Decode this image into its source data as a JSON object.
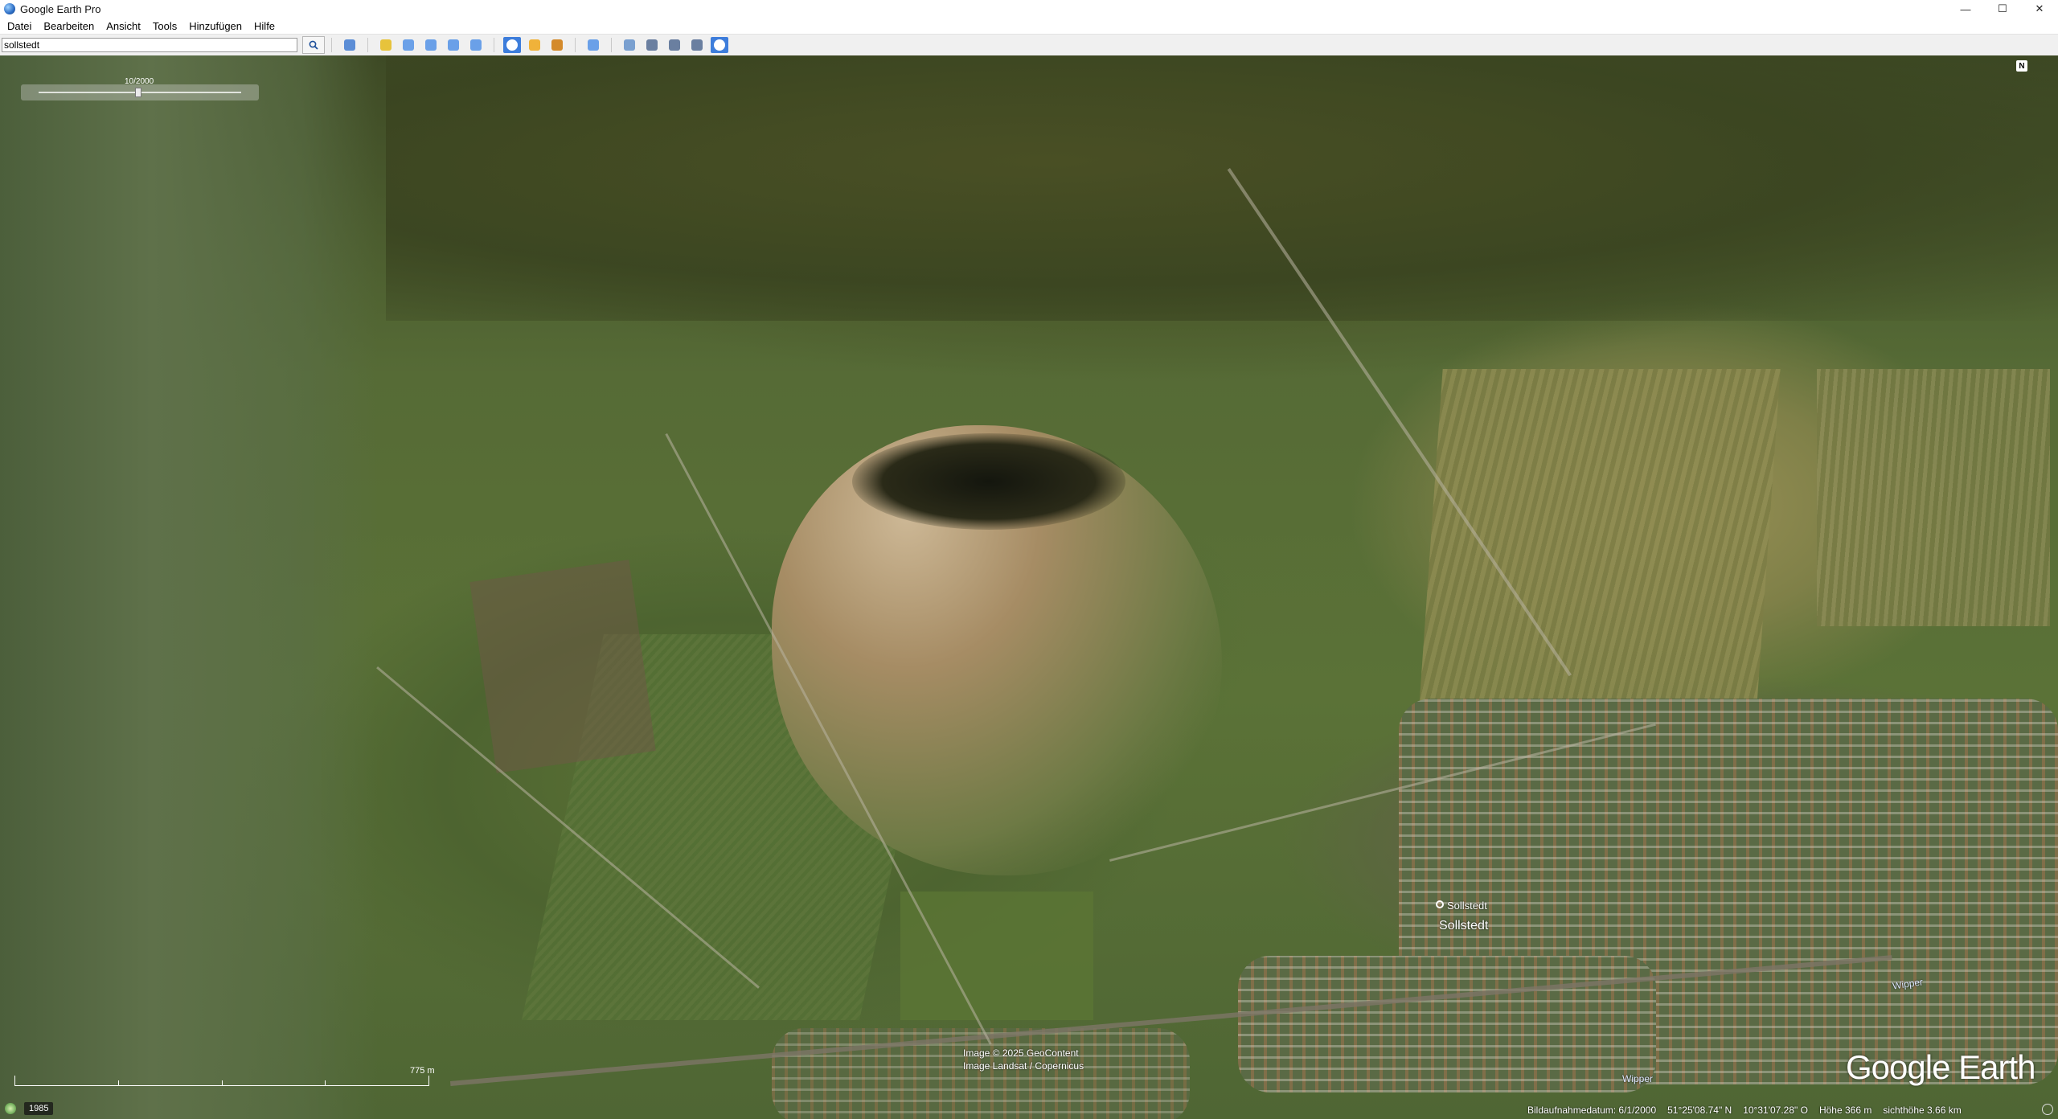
{
  "window": {
    "title": "Google Earth Pro",
    "controls": {
      "minimize": "—",
      "maximize": "☐",
      "close": "✕"
    }
  },
  "menu": {
    "items": [
      "Datei",
      "Bearbeiten",
      "Ansicht",
      "Tools",
      "Hinzufügen",
      "Hilfe"
    ]
  },
  "toolbar": {
    "search_value": "sollstedt",
    "buttons": [
      {
        "icon": "sidebar-toggle-icon",
        "color": "#5b8dd6"
      },
      {
        "icon": "placemark-icon",
        "color": "#e7c33b"
      },
      {
        "icon": "polygon-icon",
        "color": "#6aa0e8"
      },
      {
        "icon": "path-icon",
        "color": "#6aa0e8"
      },
      {
        "icon": "image-overlay-icon",
        "color": "#6aa0e8"
      },
      {
        "icon": "tour-record-icon",
        "color": "#6aa0e8"
      },
      {
        "icon": "historical-imagery-icon",
        "color": "#3d7ddb",
        "active": true
      },
      {
        "icon": "sunlight-icon",
        "color": "#f0b23a"
      },
      {
        "icon": "planets-icon",
        "color": "#d48a2a"
      },
      {
        "icon": "ruler-icon",
        "color": "#6aa0e8"
      },
      {
        "icon": "email-icon",
        "color": "#7aa0d0"
      },
      {
        "icon": "print-icon",
        "color": "#6a7fa0"
      },
      {
        "icon": "save-image-icon",
        "color": "#6a7fa0"
      },
      {
        "icon": "view-maps-icon",
        "color": "#6a7fa0"
      },
      {
        "icon": "earth-view-icon",
        "color": "#3d7ddb",
        "active": true
      }
    ]
  },
  "map": {
    "time_slider_label": "10/2000",
    "compass_label": "N",
    "places": [
      {
        "name": "Sollstedt",
        "variant": "town"
      },
      {
        "name": "Sollstedt",
        "variant": "pin"
      },
      {
        "name": "Wipper",
        "variant": "river"
      },
      {
        "name": "Wipper",
        "variant": "river"
      }
    ],
    "scale_label": "775 m",
    "copyright_lines": [
      "Image © 2025 GeoContent",
      "Image Landsat / Copernicus"
    ],
    "logo": "Google Earth",
    "historical_year": "1985"
  },
  "status": {
    "imagery_date": "Bildaufnahmedatum: 6/1/2000",
    "latitude": "51°25'08.74\" N",
    "longitude": "10°31'07.28\" O",
    "elevation": "Höhe   366 m",
    "eye_alt": "sichthöhe   3.66 km"
  }
}
